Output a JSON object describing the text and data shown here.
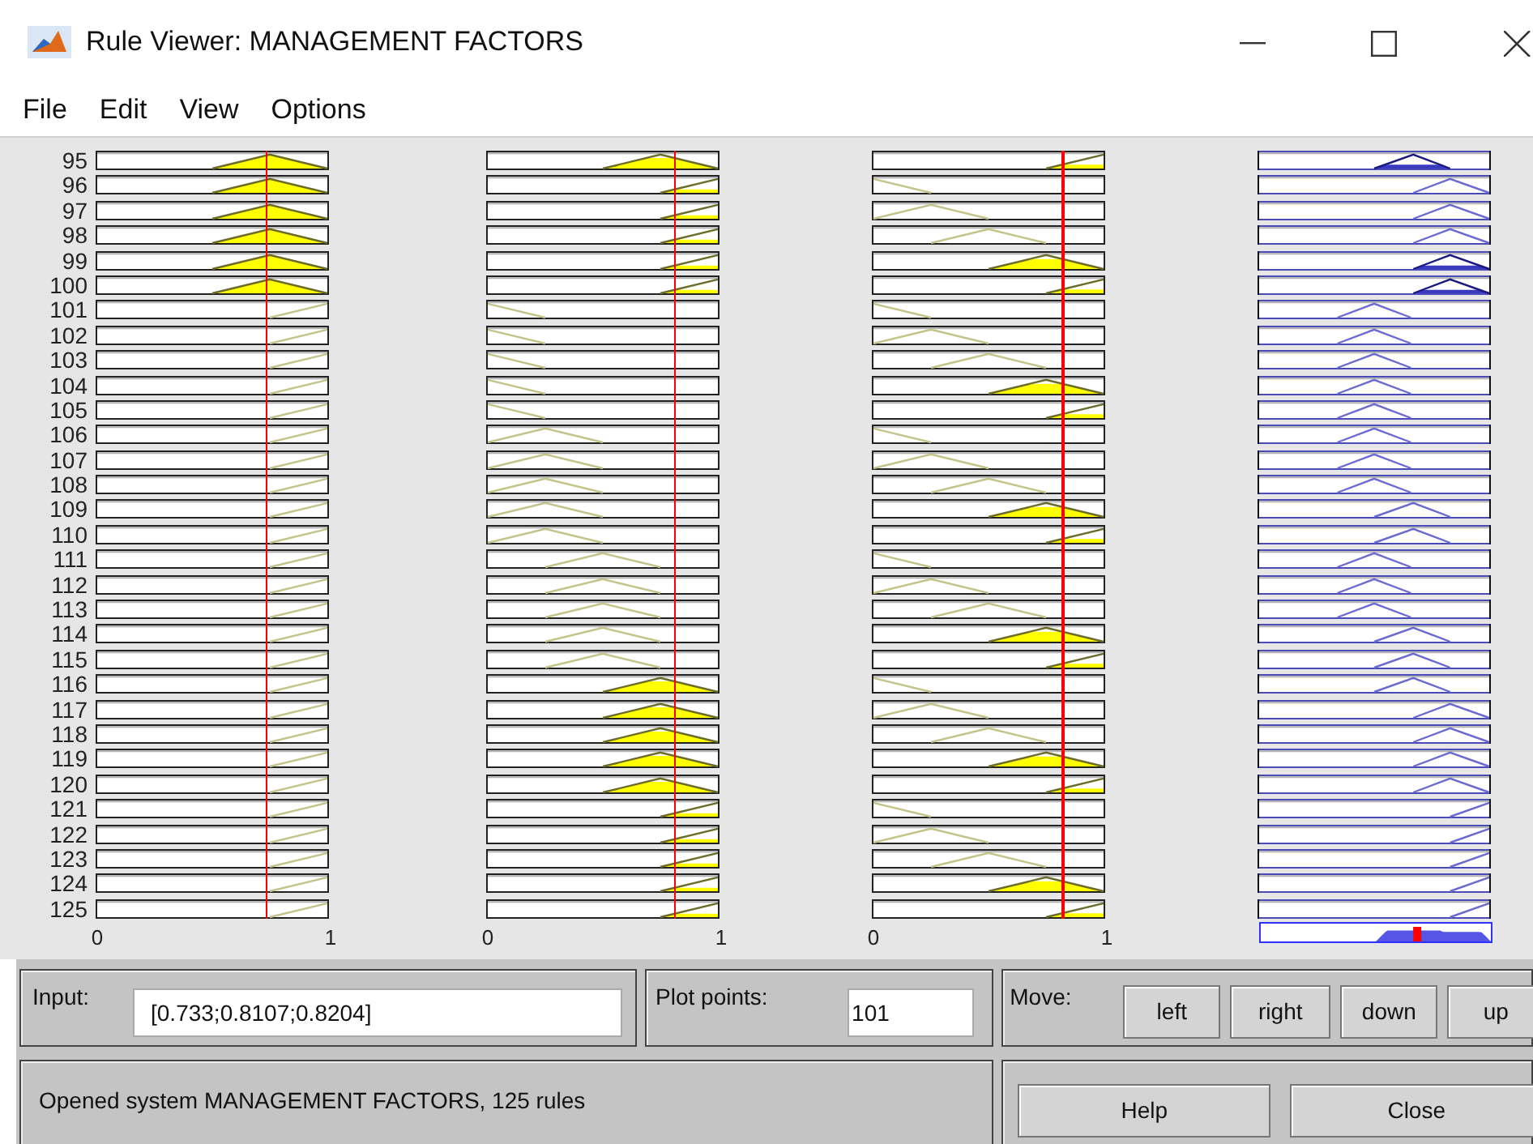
{
  "window": {
    "title": "Rule Viewer: MANAGEMENT FACTORS"
  },
  "menu": [
    {
      "label": "File"
    },
    {
      "label": "Edit"
    },
    {
      "label": "View"
    },
    {
      "label": "Options"
    }
  ],
  "axes": [
    {
      "ticks": [
        "0",
        "1"
      ]
    },
    {
      "ticks": [
        "0",
        "1"
      ]
    },
    {
      "ticks": [
        "0",
        "1"
      ]
    }
  ],
  "rules": [
    {
      "number": "95",
      "cells": [
        {
          "kind": "high",
          "filled": true
        },
        {
          "kind": "high",
          "filled": true
        },
        {
          "kind": "rising",
          "filled": true
        },
        {
          "kind": "upper",
          "filled": true
        }
      ]
    },
    {
      "number": "96",
      "cells": [
        {
          "kind": "high",
          "filled": true
        },
        {
          "kind": "rising",
          "filled": true
        },
        {
          "kind": "falling",
          "filled": false
        },
        {
          "kind": "top",
          "filled": false
        }
      ]
    },
    {
      "number": "97",
      "cells": [
        {
          "kind": "high",
          "filled": true
        },
        {
          "kind": "rising",
          "filled": true
        },
        {
          "kind": "low",
          "filled": false
        },
        {
          "kind": "top",
          "filled": false
        }
      ]
    },
    {
      "number": "98",
      "cells": [
        {
          "kind": "high",
          "filled": true
        },
        {
          "kind": "rising",
          "filled": true
        },
        {
          "kind": "medium",
          "filled": false
        },
        {
          "kind": "top",
          "filled": false
        }
      ]
    },
    {
      "number": "99",
      "cells": [
        {
          "kind": "high",
          "filled": true
        },
        {
          "kind": "rising",
          "filled": true
        },
        {
          "kind": "high",
          "filled": true
        },
        {
          "kind": "top",
          "filled": true
        }
      ]
    },
    {
      "number": "100",
      "cells": [
        {
          "kind": "high",
          "filled": true
        },
        {
          "kind": "rising",
          "filled": true
        },
        {
          "kind": "rising",
          "filled": true
        },
        {
          "kind": "top",
          "filled": true
        }
      ]
    },
    {
      "number": "101",
      "cells": [
        {
          "kind": "rising",
          "filled": false
        },
        {
          "kind": "falling",
          "filled": false
        },
        {
          "kind": "falling",
          "filled": false
        },
        {
          "kind": "centre",
          "filled": false
        }
      ]
    },
    {
      "number": "102",
      "cells": [
        {
          "kind": "rising",
          "filled": false
        },
        {
          "kind": "falling",
          "filled": false
        },
        {
          "kind": "low",
          "filled": false
        },
        {
          "kind": "centre",
          "filled": false
        }
      ]
    },
    {
      "number": "103",
      "cells": [
        {
          "kind": "rising",
          "filled": false
        },
        {
          "kind": "falling",
          "filled": false
        },
        {
          "kind": "medium",
          "filled": false
        },
        {
          "kind": "centre",
          "filled": false
        }
      ]
    },
    {
      "number": "104",
      "cells": [
        {
          "kind": "rising",
          "filled": false
        },
        {
          "kind": "falling",
          "filled": false
        },
        {
          "kind": "high",
          "filled": true
        },
        {
          "kind": "centre",
          "filled": false
        }
      ]
    },
    {
      "number": "105",
      "cells": [
        {
          "kind": "rising",
          "filled": false
        },
        {
          "kind": "falling",
          "filled": false
        },
        {
          "kind": "rising",
          "filled": true
        },
        {
          "kind": "centre",
          "filled": false
        }
      ]
    },
    {
      "number": "106",
      "cells": [
        {
          "kind": "rising",
          "filled": false
        },
        {
          "kind": "low",
          "filled": false
        },
        {
          "kind": "falling",
          "filled": false
        },
        {
          "kind": "centre",
          "filled": false
        }
      ]
    },
    {
      "number": "107",
      "cells": [
        {
          "kind": "rising",
          "filled": false
        },
        {
          "kind": "low",
          "filled": false
        },
        {
          "kind": "low",
          "filled": false
        },
        {
          "kind": "centre",
          "filled": false
        }
      ]
    },
    {
      "number": "108",
      "cells": [
        {
          "kind": "rising",
          "filled": false
        },
        {
          "kind": "low",
          "filled": false
        },
        {
          "kind": "medium",
          "filled": false
        },
        {
          "kind": "centre",
          "filled": false
        }
      ]
    },
    {
      "number": "109",
      "cells": [
        {
          "kind": "rising",
          "filled": false
        },
        {
          "kind": "low",
          "filled": false
        },
        {
          "kind": "high",
          "filled": true
        },
        {
          "kind": "upper",
          "filled": false
        }
      ]
    },
    {
      "number": "110",
      "cells": [
        {
          "kind": "rising",
          "filled": false
        },
        {
          "kind": "low",
          "filled": false
        },
        {
          "kind": "rising",
          "filled": true
        },
        {
          "kind": "upper",
          "filled": false
        }
      ]
    },
    {
      "number": "111",
      "cells": [
        {
          "kind": "rising",
          "filled": false
        },
        {
          "kind": "medium",
          "filled": false
        },
        {
          "kind": "falling",
          "filled": false
        },
        {
          "kind": "centre",
          "filled": false
        }
      ]
    },
    {
      "number": "112",
      "cells": [
        {
          "kind": "rising",
          "filled": false
        },
        {
          "kind": "medium",
          "filled": false
        },
        {
          "kind": "low",
          "filled": false
        },
        {
          "kind": "centre",
          "filled": false
        }
      ]
    },
    {
      "number": "113",
      "cells": [
        {
          "kind": "rising",
          "filled": false
        },
        {
          "kind": "medium",
          "filled": false
        },
        {
          "kind": "medium",
          "filled": false
        },
        {
          "kind": "centre",
          "filled": false
        }
      ]
    },
    {
      "number": "114",
      "cells": [
        {
          "kind": "rising",
          "filled": false
        },
        {
          "kind": "medium",
          "filled": false
        },
        {
          "kind": "high",
          "filled": true
        },
        {
          "kind": "upper",
          "filled": false
        }
      ]
    },
    {
      "number": "115",
      "cells": [
        {
          "kind": "rising",
          "filled": false
        },
        {
          "kind": "medium",
          "filled": false
        },
        {
          "kind": "rising",
          "filled": true
        },
        {
          "kind": "upper",
          "filled": false
        }
      ]
    },
    {
      "number": "116",
      "cells": [
        {
          "kind": "rising",
          "filled": false
        },
        {
          "kind": "high",
          "filled": true
        },
        {
          "kind": "falling",
          "filled": false
        },
        {
          "kind": "upper",
          "filled": false
        }
      ]
    },
    {
      "number": "117",
      "cells": [
        {
          "kind": "rising",
          "filled": false
        },
        {
          "kind": "high",
          "filled": true
        },
        {
          "kind": "low",
          "filled": false
        },
        {
          "kind": "top",
          "filled": false
        }
      ]
    },
    {
      "number": "118",
      "cells": [
        {
          "kind": "rising",
          "filled": false
        },
        {
          "kind": "high",
          "filled": true
        },
        {
          "kind": "medium",
          "filled": false
        },
        {
          "kind": "top",
          "filled": false
        }
      ]
    },
    {
      "number": "119",
      "cells": [
        {
          "kind": "rising",
          "filled": false
        },
        {
          "kind": "high",
          "filled": true
        },
        {
          "kind": "high",
          "filled": true
        },
        {
          "kind": "top",
          "filled": false
        }
      ]
    },
    {
      "number": "120",
      "cells": [
        {
          "kind": "rising",
          "filled": false
        },
        {
          "kind": "high",
          "filled": true
        },
        {
          "kind": "rising",
          "filled": true
        },
        {
          "kind": "top",
          "filled": false
        }
      ]
    },
    {
      "number": "121",
      "cells": [
        {
          "kind": "rising",
          "filled": false
        },
        {
          "kind": "rising",
          "filled": true
        },
        {
          "kind": "falling",
          "filled": false
        },
        {
          "kind": "ramp",
          "filled": false
        }
      ]
    },
    {
      "number": "122",
      "cells": [
        {
          "kind": "rising",
          "filled": false
        },
        {
          "kind": "rising",
          "filled": true
        },
        {
          "kind": "low",
          "filled": false
        },
        {
          "kind": "ramp",
          "filled": false
        }
      ]
    },
    {
      "number": "123",
      "cells": [
        {
          "kind": "rising",
          "filled": false
        },
        {
          "kind": "rising",
          "filled": true
        },
        {
          "kind": "medium",
          "filled": false
        },
        {
          "kind": "ramp",
          "filled": false
        }
      ]
    },
    {
      "number": "124",
      "cells": [
        {
          "kind": "rising",
          "filled": false
        },
        {
          "kind": "rising",
          "filled": true
        },
        {
          "kind": "high",
          "filled": true
        },
        {
          "kind": "ramp",
          "filled": false
        }
      ]
    },
    {
      "number": "125",
      "cells": [
        {
          "kind": "rising",
          "filled": false
        },
        {
          "kind": "rising",
          "filled": true
        },
        {
          "kind": "rising",
          "filled": true
        },
        {
          "kind": "ramp",
          "filled": false
        }
      ]
    }
  ],
  "input_field": {
    "label": "Input:",
    "value": "[0.733;0.8107;0.8204]"
  },
  "plot_points": {
    "label": "Plot points:",
    "value": "101"
  },
  "move": {
    "label": "Move:",
    "buttons": [
      "left",
      "right",
      "down",
      "up"
    ]
  },
  "status": "Opened system MANAGEMENT FACTORS, 125 rules",
  "buttons": [
    "Help",
    "Close"
  ]
}
